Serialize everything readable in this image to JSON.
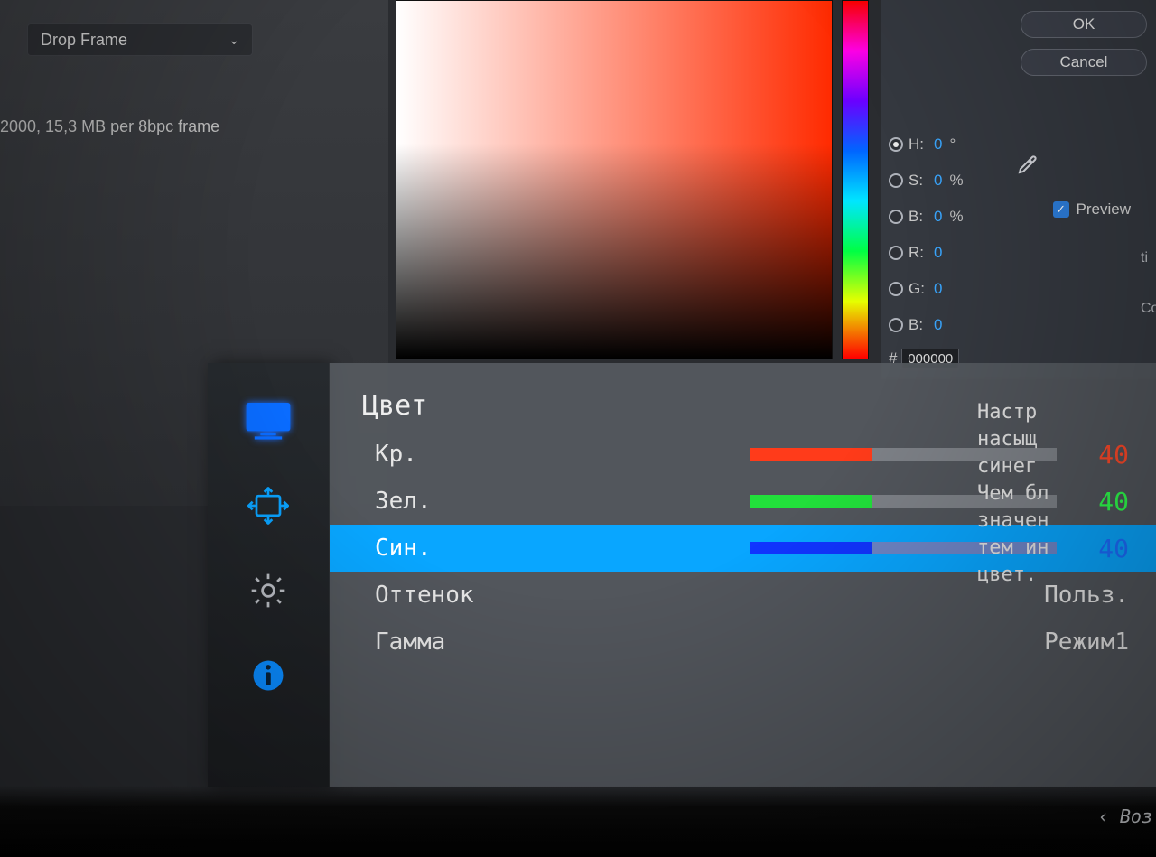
{
  "bg": {
    "drop_frame_label": "Drop Frame",
    "mb_text": "2000, 15,3 MB per 8bpc frame",
    "ok_label": "OK",
    "cancel_label": "Cancel",
    "preview_label": "Preview",
    "hex_prefix": "#",
    "hex_value": "000000",
    "hsb": {
      "H": {
        "label": "H:",
        "value": "0",
        "unit": "°"
      },
      "S": {
        "label": "S:",
        "value": "0",
        "unit": "%"
      },
      "Bness": {
        "label": "B:",
        "value": "0",
        "unit": "%"
      },
      "R": {
        "label": "R:",
        "value": "0",
        "unit": ""
      },
      "G": {
        "label": "G:",
        "value": "0",
        "unit": ""
      },
      "B": {
        "label": "B:",
        "value": "0",
        "unit": ""
      }
    },
    "side_text_cut": "ti\n\nCop"
  },
  "osd": {
    "title": "Цвет",
    "rows": {
      "red": {
        "label": "Кр.",
        "value": "40"
      },
      "green": {
        "label": "Зел.",
        "value": "40"
      },
      "blue": {
        "label": "Син.",
        "value": "40"
      },
      "hue": {
        "label": "Оттенок",
        "rvalue": "Польз."
      },
      "gamma": {
        "label": "Гамма",
        "rvalue": "Режим1"
      }
    },
    "help_text": "Настр\nнасыщ\nсинег\nЧем бл\nзначен\nтем ин\nцвет.",
    "bottom_hint": "‹  Воз"
  }
}
